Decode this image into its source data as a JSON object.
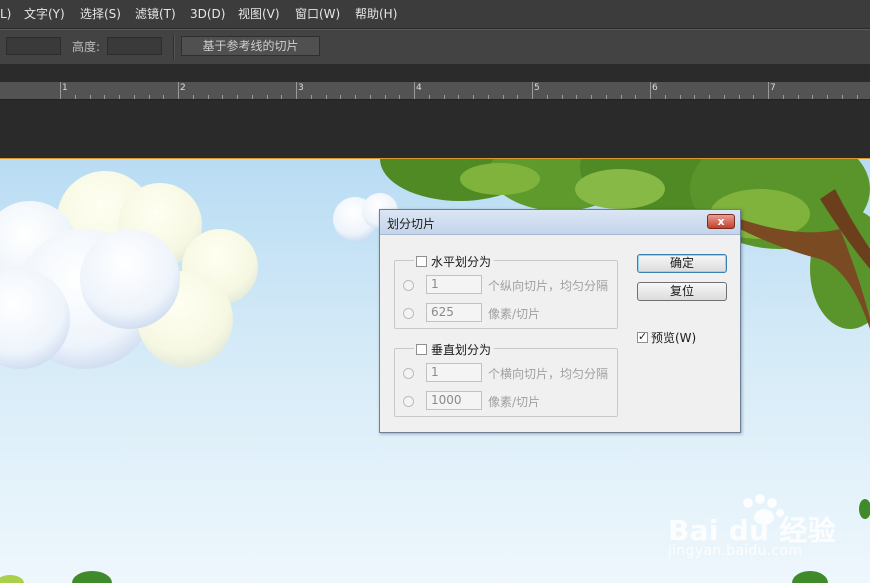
{
  "menu": {
    "items": [
      "L)",
      "文字(Y)",
      "选择(S)",
      "滤镜(T)",
      "3D(D)",
      "视图(V)",
      "窗口(W)",
      "帮助(H)"
    ]
  },
  "options": {
    "height_label": "高度:",
    "slice_from_guides_label": "基于参考线的切片"
  },
  "ruler": {
    "numbers": [
      "1",
      "2",
      "3",
      "4",
      "5",
      "6",
      "7"
    ]
  },
  "dialog": {
    "title": "划分切片",
    "close_glyph": "x",
    "horizontal": {
      "label": "水平划分为",
      "checked": false,
      "count_value": "1",
      "count_unit": "个纵向切片，均匀分隔",
      "pixel_value": "625",
      "pixel_unit": "像素/切片"
    },
    "vertical": {
      "label": "垂直划分为",
      "checked": false,
      "count_value": "1",
      "count_unit": "个横向切片，均匀分隔",
      "pixel_value": "1000",
      "pixel_unit": "像素/切片"
    },
    "ok_label": "确定",
    "reset_label": "复位",
    "preview_label": "预览(W)",
    "preview_checked": true
  },
  "watermark": {
    "brand": "Bai du 经验",
    "url": "jingyan.baidu.com"
  },
  "colors": {
    "sky_top": "#bfe0f5",
    "sky_bottom": "#e8f4fb",
    "foliage": "#5a8f2a",
    "dialog_bg": "#f0f0f0",
    "close_button": "#c4402c"
  }
}
